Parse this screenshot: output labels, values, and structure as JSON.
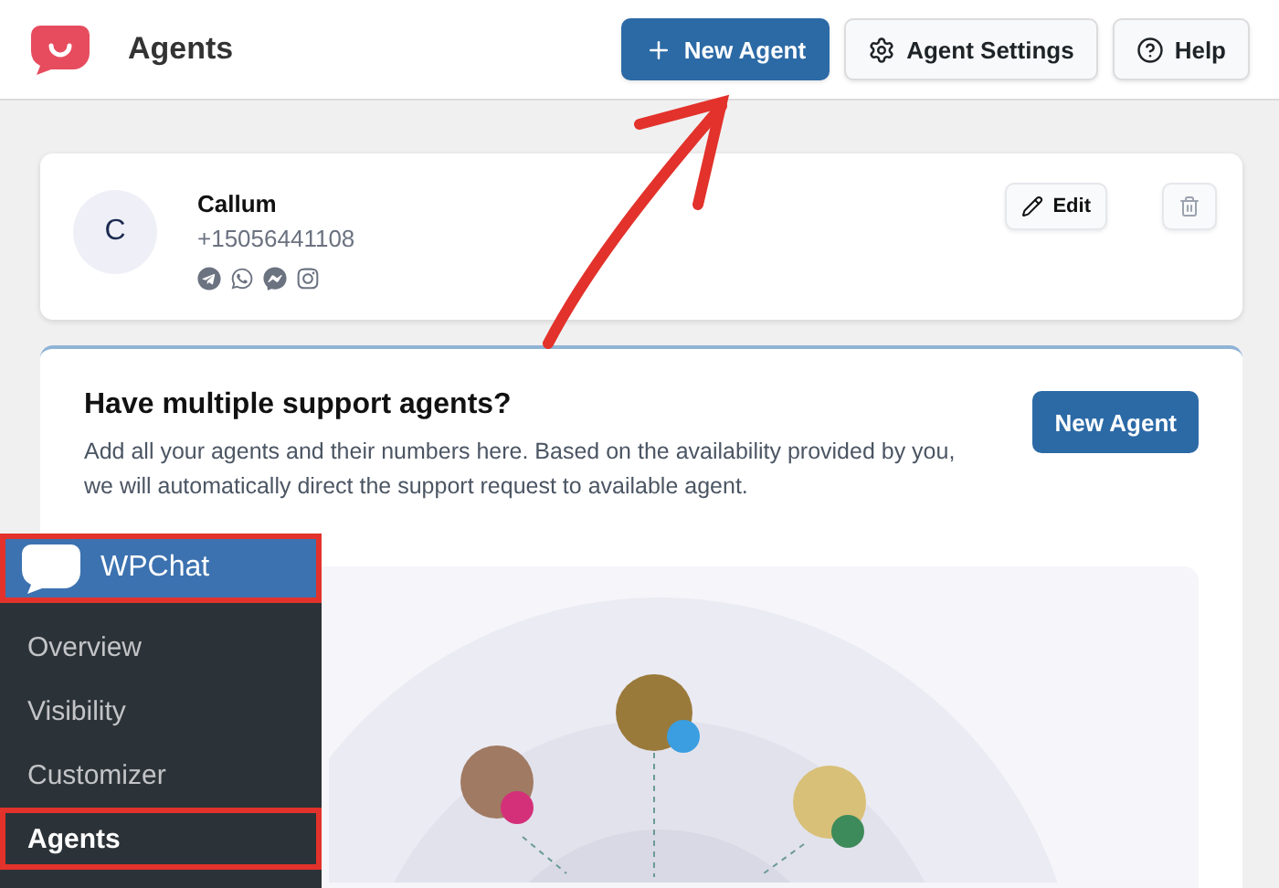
{
  "header": {
    "title": "Agents",
    "buttons": [
      {
        "kind": "primary",
        "label": "New Agent"
      },
      {
        "kind": "settings",
        "label": "Agent Settings"
      },
      {
        "kind": "help",
        "label": "Help"
      }
    ]
  },
  "agents": [
    {
      "initial": "C",
      "name": "Callum",
      "phone": "+15056441108",
      "actions": [
        {
          "kind": "edit",
          "label": "Edit"
        },
        {
          "kind": "delete"
        }
      ]
    }
  ],
  "promo": {
    "title": "Have multiple support agents?",
    "text": "Add all your agents and their numbers here. Based on the availability provided by you, we will automatically direct the support request to available agent.",
    "button": "New Agent"
  },
  "sidebar": {
    "header": {
      "label": "WPChat",
      "highlighted": true
    },
    "items": [
      {
        "label": "Overview",
        "selected": false,
        "highlighted": false
      },
      {
        "label": "Visibility",
        "selected": false,
        "highlighted": false
      },
      {
        "label": "Customizer",
        "selected": false,
        "highlighted": false
      },
      {
        "label": "Agents",
        "selected": true,
        "highlighted": true
      }
    ]
  }
}
